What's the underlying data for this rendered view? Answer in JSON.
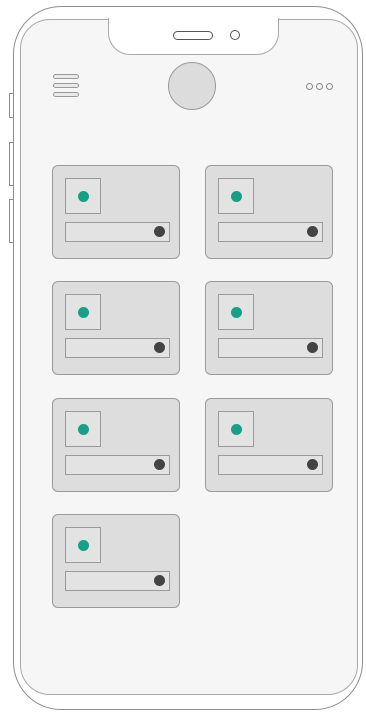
{
  "colors": {
    "accent": "#16a088",
    "knob": "#444444",
    "card_bg": "#dddddd",
    "screen_bg": "#f5f6f5",
    "outline": "#9a9a9a"
  },
  "header": {
    "menu_icon": "hamburger-menu-icon",
    "avatar_icon": "avatar-placeholder",
    "more_icon": "more-options-icon"
  },
  "cards": [
    {
      "thumb_icon": "image-placeholder-icon",
      "control_icon": "toggle-knob"
    },
    {
      "thumb_icon": "image-placeholder-icon",
      "control_icon": "toggle-knob"
    },
    {
      "thumb_icon": "image-placeholder-icon",
      "control_icon": "toggle-knob"
    },
    {
      "thumb_icon": "image-placeholder-icon",
      "control_icon": "toggle-knob"
    },
    {
      "thumb_icon": "image-placeholder-icon",
      "control_icon": "toggle-knob"
    },
    {
      "thumb_icon": "image-placeholder-icon",
      "control_icon": "toggle-knob"
    },
    {
      "thumb_icon": "image-placeholder-icon",
      "control_icon": "toggle-knob"
    }
  ]
}
